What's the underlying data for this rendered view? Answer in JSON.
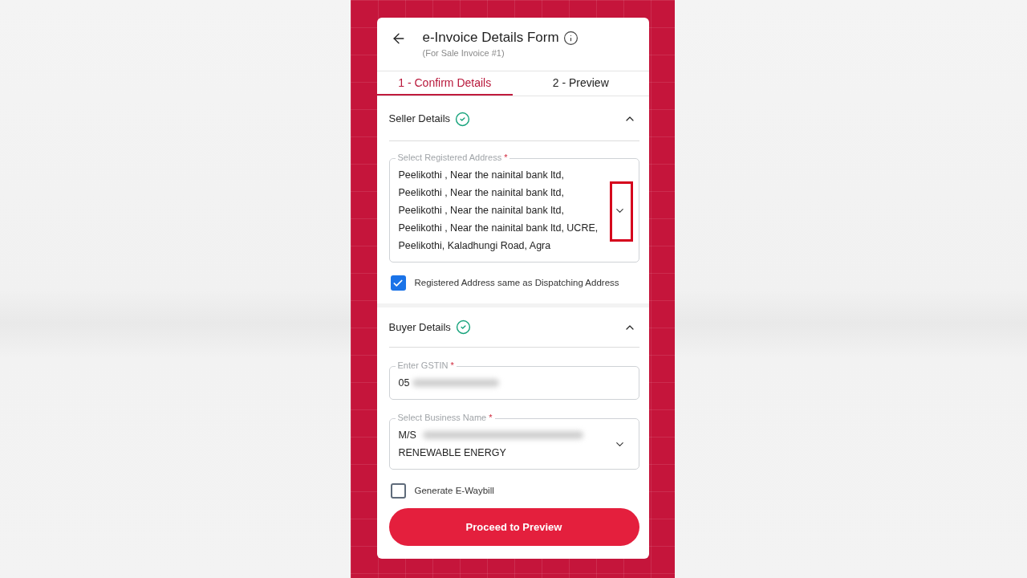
{
  "header": {
    "title": "e-Invoice Details Form",
    "subtitle": "(For Sale Invoice #1)"
  },
  "tabs": [
    {
      "label": "1 - Confirm Details",
      "selected": true
    },
    {
      "label": "2 - Preview",
      "selected": false
    }
  ],
  "sections": [
    {
      "title": "Seller Details",
      "complete": true,
      "expanded": true,
      "fields": [
        {
          "kind": "select",
          "label": "Select Registered Address",
          "required_mark": "*",
          "value_lines": [
            "Peelikothi , Near the nainital bank ltd,",
            "Peelikothi , Near the nainital bank ltd,",
            "Peelikothi , Near the nainital bank ltd,",
            "Peelikothi , Near the nainital bank ltd, UCRE,",
            "Peelikothi, Kaladhungi Road, Agra"
          ],
          "redacted": false,
          "highlighted": true
        }
      ],
      "checkbox": {
        "label": "Registered Address same as Dispatching Address",
        "checked": true
      }
    },
    {
      "title": "Buyer Details",
      "complete": true,
      "expanded": true,
      "fields": [
        {
          "kind": "text",
          "label": "Enter GSTIN",
          "required_mark": "*",
          "value_lines": [
            "05"
          ],
          "redacted": true,
          "highlighted": false
        },
        {
          "kind": "select",
          "label": "Select Business Name",
          "required_mark": "*",
          "value_lines": [
            "M/S",
            "RENEWABLE ENERGY"
          ],
          "redacted": true,
          "highlighted": false
        }
      ],
      "checkbox": {
        "label": "Generate E-Waybill",
        "checked": false
      }
    }
  ],
  "primary_button": {
    "label": "Proceed to Preview"
  }
}
